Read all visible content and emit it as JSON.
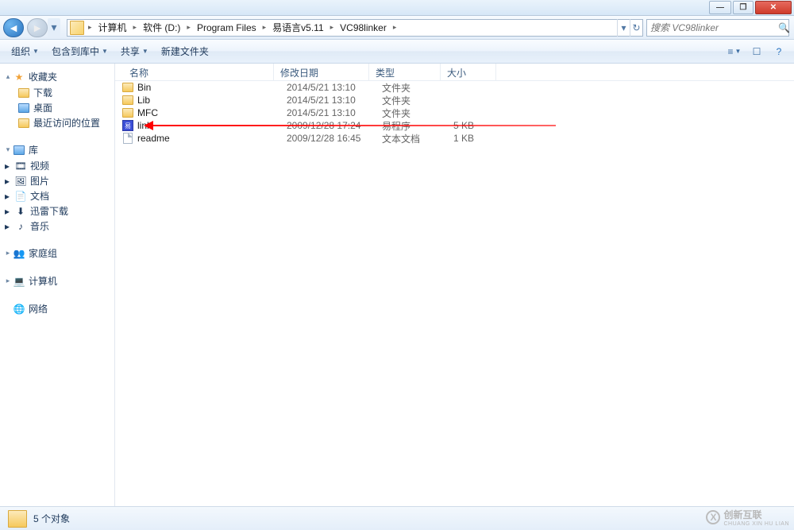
{
  "titlebar": {
    "min": "—",
    "max": "❐",
    "close": "✕"
  },
  "nav": {
    "crumbs": [
      "计算机",
      "软件 (D:)",
      "Program Files",
      "易语言v5.11",
      "VC98linker"
    ],
    "sep": "▸",
    "refresh": "↻"
  },
  "search": {
    "placeholder": "搜索 VC98linker"
  },
  "toolbar": {
    "organize": "组织",
    "include": "包含到库中",
    "share": "共享",
    "newfolder": "新建文件夹"
  },
  "sidebar": {
    "fav": {
      "label": "收藏夹",
      "items": [
        "下载",
        "桌面",
        "最近访问的位置"
      ]
    },
    "lib": {
      "label": "库",
      "items": [
        "视频",
        "图片",
        "文档",
        "迅雷下载",
        "音乐"
      ]
    },
    "home": {
      "label": "家庭组"
    },
    "pc": {
      "label": "计算机"
    },
    "net": {
      "label": "网络"
    }
  },
  "columns": {
    "name": "名称",
    "date": "修改日期",
    "type": "类型",
    "size": "大小"
  },
  "files": [
    {
      "icon": "folder",
      "name": "Bin",
      "date": "2014/5/21 13:10",
      "type": "文件夹",
      "size": ""
    },
    {
      "icon": "folder",
      "name": "Lib",
      "date": "2014/5/21 13:10",
      "type": "文件夹",
      "size": ""
    },
    {
      "icon": "folder",
      "name": "MFC",
      "date": "2014/5/21 13:10",
      "type": "文件夹",
      "size": ""
    },
    {
      "icon": "app",
      "name": "link",
      "date": "2009/12/28 17:24",
      "type": "易程序",
      "size": "5 KB"
    },
    {
      "icon": "doc",
      "name": "readme",
      "date": "2009/12/28 16:45",
      "type": "文本文档",
      "size": "1 KB"
    }
  ],
  "status": {
    "text": "5 个对象"
  },
  "watermark": {
    "text": "创新互联",
    "sub": "CHUANG XIN HU LIAN"
  }
}
